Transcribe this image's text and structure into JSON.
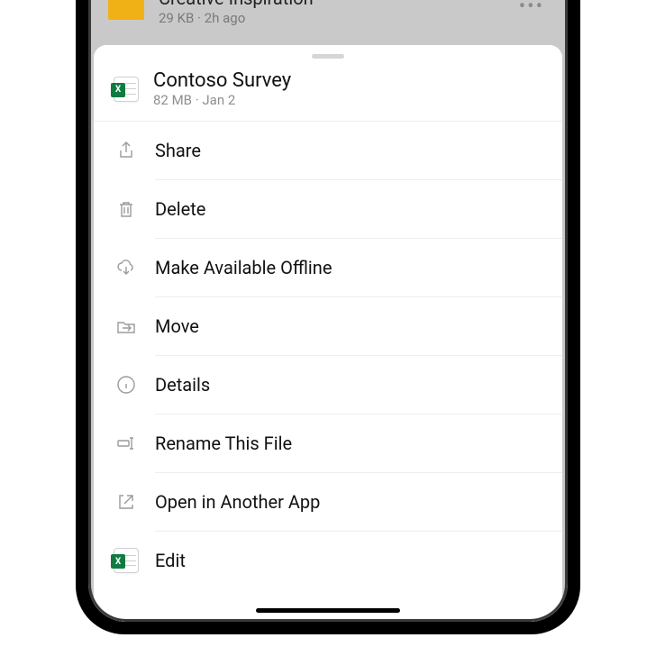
{
  "background_item": {
    "name": "Creative Inspiration",
    "meta": "29 KB · 2h ago"
  },
  "sheet": {
    "file": {
      "name": "Contoso Survey",
      "meta": "82 MB · Jan 2"
    },
    "actions": [
      {
        "id": "share",
        "label": "Share",
        "icon": "share-icon"
      },
      {
        "id": "delete",
        "label": "Delete",
        "icon": "trash-icon"
      },
      {
        "id": "offline",
        "label": "Make Available Offline",
        "icon": "cloud-download-icon"
      },
      {
        "id": "move",
        "label": "Move",
        "icon": "move-folder-icon"
      },
      {
        "id": "details",
        "label": "Details",
        "icon": "info-icon"
      },
      {
        "id": "rename",
        "label": "Rename This File",
        "icon": "rename-icon"
      },
      {
        "id": "open",
        "label": "Open in Another App",
        "icon": "open-external-icon"
      },
      {
        "id": "edit",
        "label": "Edit",
        "icon": "excel-app-icon"
      }
    ]
  }
}
